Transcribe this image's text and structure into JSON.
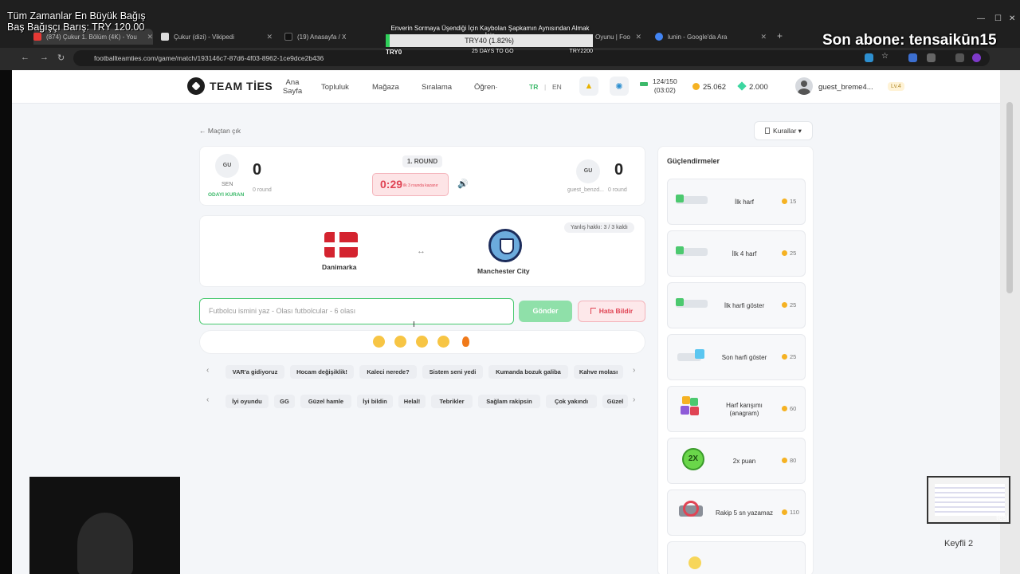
{
  "overlay": {
    "top_line1": "Tüm Zamanlar En Büyük Bağış",
    "top_line2": "Baş Bağışçı Barış: TRY 120.00",
    "last_sub": "Son abone: tensaikūn15",
    "donation_title": "Enverin Sormaya Üşendiği İçin Kaybolan Şapkamın Aynısından Almak İçin",
    "donation_value": "TRY40 (1.82%)",
    "donation_progress_percent": 1.82,
    "donation_left": "TRY0",
    "donation_center": "25 DAYS TO GO",
    "donation_right": "TRY2200",
    "mini_text": "tesi",
    "faint_text": "Keyfli 2"
  },
  "browser": {
    "tabs": [
      {
        "label": "(874) Çukur 1. Bölüm (4K) - You",
        "color": "#e53935"
      },
      {
        "label": "Çukur (dizi) - Vikipedi",
        "color": "#dddddd"
      },
      {
        "label": "(19) Anasayfa / X",
        "color": "#111111"
      },
      {
        "label": "Oyunu | Foo",
        "color": "#3cb96a"
      },
      {
        "label": "lunin - Google'da Ara",
        "color": "#4285f4"
      }
    ],
    "url": "footballteamties.com/game/match/193146c7-87d6-4f03-8962-1ce9dce2b436",
    "new_tab": "+"
  },
  "site": {
    "logo": "TEAM TİES",
    "nav": [
      "Ana Sayfa",
      "Topluluk",
      "Mağaza",
      "Sıralama",
      "Öğren·"
    ],
    "lang_tr": "TR",
    "lang_sep": "|",
    "lang_en": "EN",
    "energy": "124/150",
    "energy_timer": "(03:02)",
    "coins": "25.062",
    "gems": "2.000",
    "username": "guest_breme4...",
    "level": "Lv.4",
    "colors": {
      "accent": "#3cb96a",
      "danger": "#e04454"
    }
  },
  "game": {
    "back": "← Maçtan çık",
    "rules": "Kurallar ▾",
    "left_badge": "GU",
    "left_you": "SEN",
    "left_host": "ODAYI KURAN",
    "left_score": "0",
    "left_round": "0 round",
    "round_label": "1. ROUND",
    "timer": "0:29",
    "timer_sub": "ilk 3 rounda kazanır",
    "right_badge": "GU",
    "right_name": "guest_benzd...",
    "right_score": "0",
    "right_round": "0 round",
    "wrong_guesses": "Yanlış hakkı: 3 / 3 kaldı",
    "team1": "Danimarka",
    "team2": "Manchester City",
    "swap": "↔",
    "input_placeholder": "Futbolcu ismini yaz - Olası futbolcular - 6 olası",
    "send": "Gönder",
    "report": "Hata Bildir",
    "quick_row1": [
      "VAR'a gidiyoruz",
      "Hocam değişiklik!",
      "Kaleci nerede?",
      "Sistem seni yedi",
      "Kumanda bozuk galiba",
      "Kahve molası"
    ],
    "quick_row2": [
      "İyi oyundu",
      "GG",
      "Güzel hamle",
      "İyi bildin",
      "Helal!",
      "Tebrikler",
      "Sağlam rakipsin",
      "Çok yakındı",
      "Güzel"
    ],
    "arrow_left": "‹",
    "arrow_right": "›"
  },
  "powerups": {
    "title": "Güçlendirmeler",
    "items": [
      {
        "label": "İlk harf",
        "cost": "15"
      },
      {
        "label": "İlk 4 harf",
        "cost": "25"
      },
      {
        "label": "İlk harfi göster",
        "cost": "25"
      },
      {
        "label": "Son harfi göster",
        "cost": "25"
      },
      {
        "label": "Harf karışımı (anagram)",
        "cost": "60"
      },
      {
        "label": "2x puan",
        "cost": "80"
      },
      {
        "label": "Rakip 5 sn yazamaz",
        "cost": "110"
      }
    ]
  }
}
